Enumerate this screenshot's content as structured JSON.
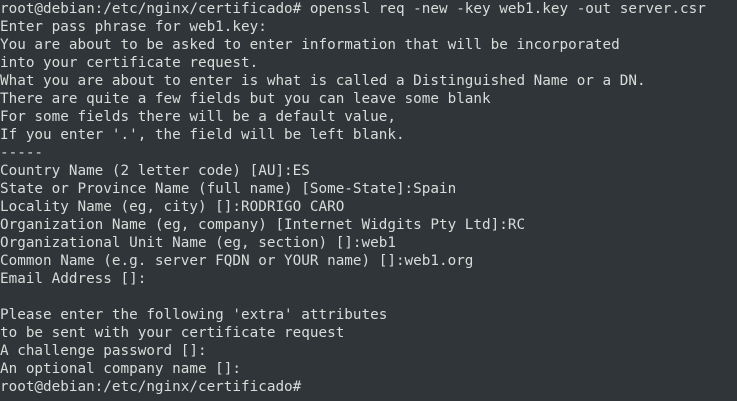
{
  "terminal": {
    "background": "#2f3539",
    "foreground": "#d9dcd9",
    "lines": [
      "root@debian:/etc/nginx/certificado# openssl req -new -key web1.key -out server.csr",
      "Enter pass phrase for web1.key:",
      "You are about to be asked to enter information that will be incorporated",
      "into your certificate request.",
      "What you are about to enter is what is called a Distinguished Name or a DN.",
      "There are quite a few fields but you can leave some blank",
      "For some fields there will be a default value,",
      "If you enter '.', the field will be left blank.",
      "-----",
      "Country Name (2 letter code) [AU]:ES",
      "State or Province Name (full name) [Some-State]:Spain",
      "Locality Name (eg, city) []:RODRIGO CARO",
      "Organization Name (eg, company) [Internet Widgits Pty Ltd]:RC",
      "Organizational Unit Name (eg, section) []:web1",
      "Common Name (e.g. server FQDN or YOUR name) []:web1.org",
      "Email Address []:",
      "",
      "Please enter the following 'extra' attributes",
      "to be sent with your certificate request",
      "A challenge password []:",
      "An optional company name []:"
    ],
    "prompt": "root@debian:/etc/nginx/certificado#"
  }
}
